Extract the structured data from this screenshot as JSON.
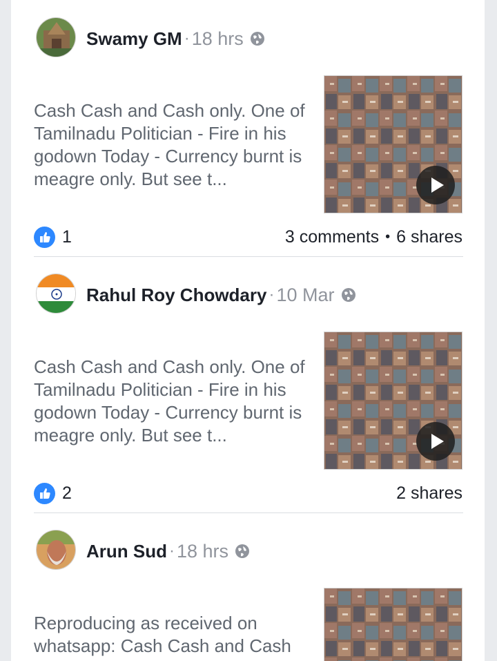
{
  "posts": [
    {
      "author": "Swamy GM",
      "separator": "·",
      "time": "18 hrs",
      "privacy_icon": "globe-icon",
      "text": "Cash Cash and Cash only.  One of Tamilnadu Politician - Fire in his godown Today -  Currency burnt is meagre only.  But see t...",
      "likes": "1",
      "comments": "3 comments",
      "dot": "•",
      "shares": "6 shares"
    },
    {
      "author": "Rahul Roy Chowdary",
      "separator": "·",
      "time": "10 Mar",
      "privacy_icon": "globe-icon",
      "text": "Cash Cash and Cash only.  One of Tamilnadu Politician - Fire in his godown Today -  Currency burnt is meagre only.  But see t...",
      "likes": "2",
      "shares": "2 shares"
    },
    {
      "author": "Arun Sud",
      "separator": "·",
      "time": "18 hrs",
      "privacy_icon": "globe-icon",
      "text": "Reproducing as received on whatsapp: Cash Cash and Cash"
    }
  ],
  "colors": {
    "like_blue": "#2d88ff",
    "name": "#1d2129",
    "meta": "#90949c",
    "body_text": "#606770",
    "background": "#e9ebee"
  }
}
